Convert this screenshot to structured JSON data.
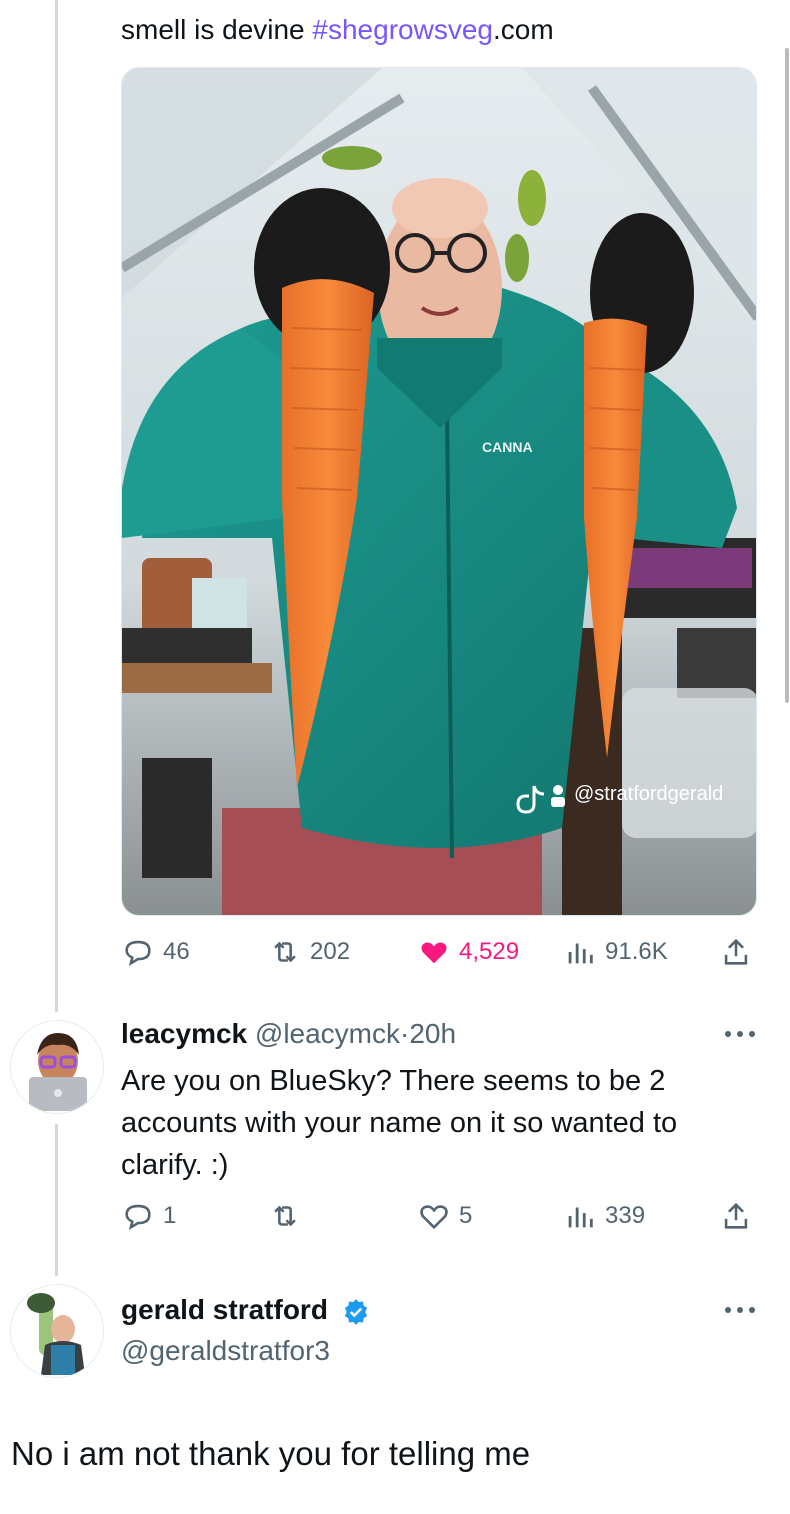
{
  "tweet_top": {
    "text_plain": "smell is devine ",
    "hashtag": "#shegrowsveg",
    "text_suffix": ".com",
    "media_watermark": "@stratfordgerald",
    "media_shirt_logo": "CANNA",
    "stats": {
      "replies": "46",
      "reposts": "202",
      "likes": "4,529",
      "views": "91.6K"
    }
  },
  "reply": {
    "display_name": "leacymck",
    "handle": "@leacymck",
    "separator": "·",
    "time": "20h",
    "text": "Are you on BlueSky?  There seems to be 2 accounts with your name on it so wanted to clarify.  :)",
    "stats": {
      "replies": "1",
      "reposts": "",
      "likes": "5",
      "views": "339"
    }
  },
  "author_reply": {
    "display_name": "gerald stratford",
    "handle": "@geraldstratfor3",
    "verified": true,
    "text": "No i am not thank you for telling me"
  },
  "colors": {
    "accent_purple": "#7856ff",
    "like_pink": "#f91880",
    "verified_blue": "#1d9bf0",
    "muted_gray": "#536471"
  },
  "icons": [
    "reply-icon",
    "repost-icon",
    "heart-icon",
    "views-icon",
    "share-icon",
    "more-icon",
    "verified-icon",
    "tiktok-icon"
  ]
}
